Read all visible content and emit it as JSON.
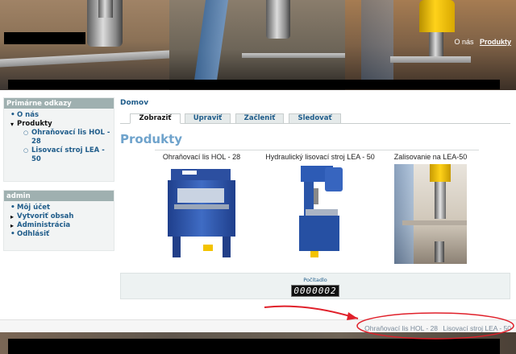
{
  "header": {
    "nav": [
      "O nás",
      "Produkty"
    ]
  },
  "sidebar": {
    "primary": {
      "title": "Primárne odkazy",
      "items": [
        {
          "label": "O nás"
        },
        {
          "label": "Produkty"
        },
        {
          "label": "Ohraňovací lis HOL - 28"
        },
        {
          "label": "Lisovací stroj LEA - 50"
        }
      ]
    },
    "user": {
      "title": "admin",
      "items": [
        {
          "label": "Môj účet"
        },
        {
          "label": "Vytvoriť obsah"
        },
        {
          "label": "Administrácia"
        },
        {
          "label": "Odhlásiť"
        }
      ]
    }
  },
  "main": {
    "breadcrumb": "Domov",
    "tabs": [
      {
        "label": "Zobraziť"
      },
      {
        "label": "Upraviť"
      },
      {
        "label": "Začleniť"
      },
      {
        "label": "Sledovať"
      }
    ],
    "title": "Produkty",
    "products": [
      {
        "caption": "Ohraňovací lis HOL - 28"
      },
      {
        "caption": "Hydraulický lisovací stroj LEA - 50"
      },
      {
        "caption": "Zalisovanie na LEA-50"
      }
    ],
    "counter": {
      "label": "Počítadlo",
      "value": "0000002"
    }
  },
  "footer": {
    "links": [
      "Ohraňovací lis HOL - 28",
      "Lisovací stroj LEA - 50"
    ]
  },
  "colors": {
    "link": "#1f5c8a",
    "title": "#6fa3cc",
    "block_header": "#9fb0b0",
    "annotation": "#e0202a"
  }
}
